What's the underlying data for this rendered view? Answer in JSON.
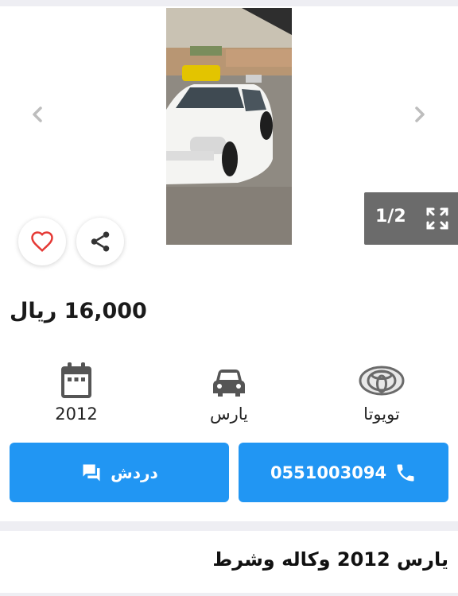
{
  "gallery": {
    "counter": "1/2",
    "prev_icon": "chevron-left-icon",
    "next_icon": "chevron-right-icon",
    "expand_icon": "expand-icon"
  },
  "actions": {
    "favorite_icon": "heart-icon",
    "share_icon": "share-icon"
  },
  "listing": {
    "price": "16,000 ريال",
    "title": "يارس 2012 وكاله وشرط"
  },
  "specs": {
    "year": "2012",
    "model": "يارس",
    "make": "تويوتا"
  },
  "buttons": {
    "chat_label": "دردش",
    "phone_number": "0551003094"
  },
  "colors": {
    "primary": "#2196f3",
    "heart": "#e53935",
    "counter_bg": "#6b6b6b",
    "divider": "#eeeef3"
  }
}
